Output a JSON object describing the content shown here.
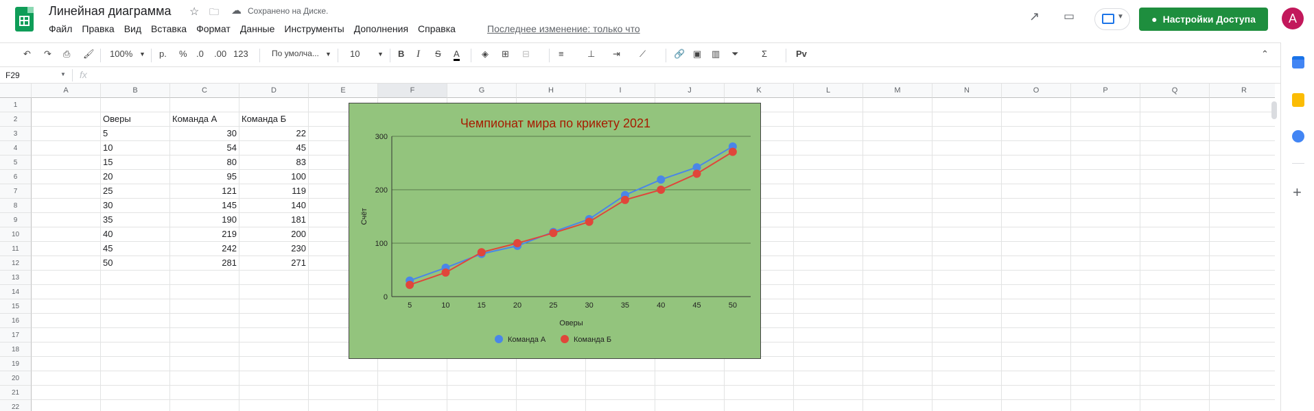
{
  "app": {
    "doc_title": "Линейная диаграмма",
    "saved_status": "Сохранено на Диске.",
    "menu": [
      "Файл",
      "Правка",
      "Вид",
      "Вставка",
      "Формат",
      "Данные",
      "Инструменты",
      "Дополнения",
      "Справка"
    ],
    "last_edit": "Последнее изменение: только что",
    "share_label": "Настройки Доступа",
    "avatar_initial": "A"
  },
  "toolbar": {
    "zoom": "100%",
    "currency": "р.",
    "percent": "%",
    "dec_decrease": ".0",
    "dec_increase": ".00",
    "more_formats": "123",
    "font": "По умолча...",
    "font_size": "10",
    "bold": "B",
    "italic": "I",
    "strike": "S",
    "text_color": "A",
    "input_tools": "Рv"
  },
  "formula_bar": {
    "name_box": "F29",
    "fx": "fx",
    "value": ""
  },
  "columns": [
    "A",
    "B",
    "C",
    "D",
    "E",
    "F",
    "G",
    "H",
    "I",
    "J",
    "K",
    "L",
    "M",
    "N",
    "O",
    "P",
    "Q",
    "R"
  ],
  "rows": [
    "1",
    "2",
    "3",
    "4",
    "5",
    "6",
    "7",
    "8",
    "9",
    "10",
    "11",
    "12",
    "13",
    "14",
    "15",
    "16",
    "17",
    "18",
    "19",
    "20",
    "21",
    "22"
  ],
  "table": {
    "headers": [
      "Оверы",
      "Команда А",
      "Команда Б"
    ],
    "rows": [
      [
        "5",
        "30",
        "22"
      ],
      [
        "10",
        "54",
        "45"
      ],
      [
        "15",
        "80",
        "83"
      ],
      [
        "20",
        "95",
        "100"
      ],
      [
        "25",
        "121",
        "119"
      ],
      [
        "30",
        "145",
        "140"
      ],
      [
        "35",
        "190",
        "181"
      ],
      [
        "40",
        "219",
        "200"
      ],
      [
        "45",
        "242",
        "230"
      ],
      [
        "50",
        "281",
        "271"
      ]
    ]
  },
  "colors": {
    "chart_bg": "#93c47d",
    "series_a": "#4a86e8",
    "series_b": "#e0463a",
    "title": "#a61c00",
    "share_green": "#1e8e3e"
  },
  "chart_data": {
    "type": "line",
    "title": "Чемпионат мира по крикету 2021",
    "xlabel": "Оверы",
    "ylabel": "Счёт",
    "categories": [
      "5",
      "10",
      "15",
      "20",
      "25",
      "30",
      "35",
      "40",
      "45",
      "50"
    ],
    "ylim": [
      0,
      300
    ],
    "yticks": [
      "0",
      "100",
      "200",
      "300"
    ],
    "legend": "bottom",
    "grid": true,
    "series": [
      {
        "name": "Команда А",
        "values": [
          30,
          54,
          80,
          95,
          121,
          145,
          190,
          219,
          242,
          281
        ]
      },
      {
        "name": "Команда Б",
        "values": [
          22,
          45,
          83,
          100,
          119,
          140,
          181,
          200,
          230,
          271
        ]
      }
    ]
  }
}
